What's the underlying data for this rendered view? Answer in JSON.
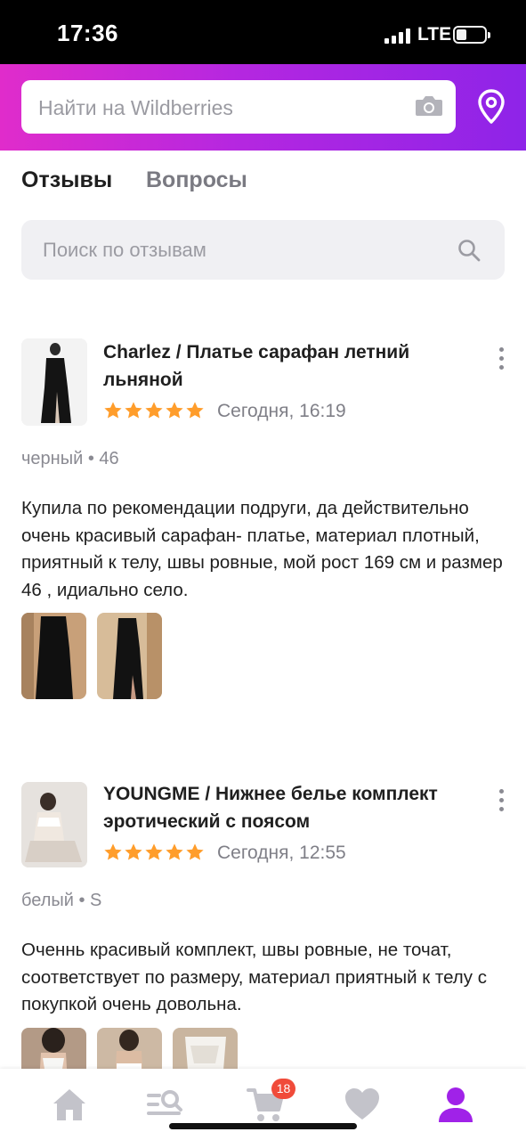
{
  "status_bar": {
    "time": "17:36",
    "network": "LTE"
  },
  "header": {
    "search_placeholder": "Найти на Wildberries"
  },
  "tabs": [
    {
      "label": "Отзывы",
      "active": true
    },
    {
      "label": "Вопросы",
      "active": false
    }
  ],
  "review_search": {
    "placeholder": "Поиск по отзывам"
  },
  "reviews": [
    {
      "product": "Charlez / Платье сарафан летний льняной",
      "rating": 5,
      "date": "Сегодня, 16:19",
      "variant": "черный • 46",
      "text": "Купила по рекомендации подруги, да действительно очень красивый сарафан- платье, материал плотный, приятный к телу, швы ровные, мой рост 169 см и размер 46 , идиально село.",
      "photo_count": 2
    },
    {
      "product": "YOUNGME / Нижнее белье комплект эротический с поясом",
      "rating": 5,
      "date": "Сегодня, 12:55",
      "variant": "белый • S",
      "text": "Оченнь красивый комплект, швы ровные, не точат, соответствует по размеру, материал приятный к телу с покупкой очень довольна.",
      "photo_count": 3
    }
  ],
  "bottom_nav": {
    "items": [
      "home-icon",
      "catalog-icon",
      "cart-icon",
      "favorites-icon",
      "profile-icon"
    ],
    "cart_badge": "18",
    "active": "profile-icon"
  },
  "colors": {
    "accent": "#a022e8",
    "star": "#ff9d2b",
    "badge": "#f04b3a"
  }
}
